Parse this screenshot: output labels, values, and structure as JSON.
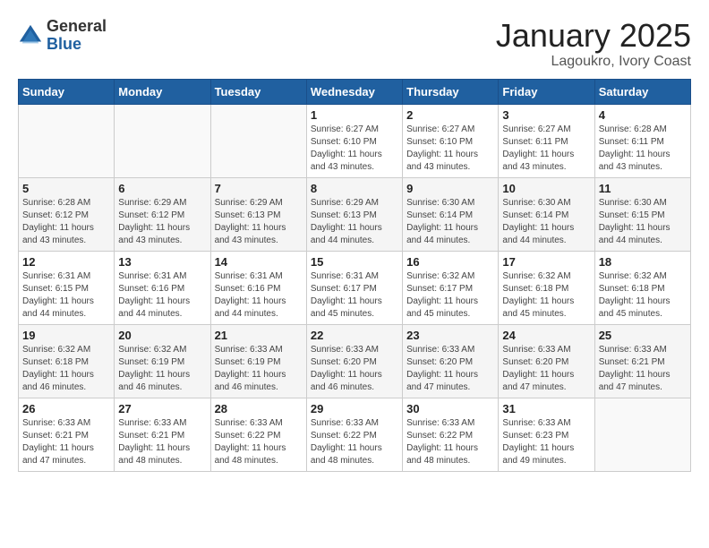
{
  "logo": {
    "general": "General",
    "blue": "Blue"
  },
  "title": "January 2025",
  "subtitle": "Lagoukro, Ivory Coast",
  "weekdays": [
    "Sunday",
    "Monday",
    "Tuesday",
    "Wednesday",
    "Thursday",
    "Friday",
    "Saturday"
  ],
  "weeks": [
    [
      {
        "day": "",
        "info": ""
      },
      {
        "day": "",
        "info": ""
      },
      {
        "day": "",
        "info": ""
      },
      {
        "day": "1",
        "info": "Sunrise: 6:27 AM\nSunset: 6:10 PM\nDaylight: 11 hours\nand 43 minutes."
      },
      {
        "day": "2",
        "info": "Sunrise: 6:27 AM\nSunset: 6:10 PM\nDaylight: 11 hours\nand 43 minutes."
      },
      {
        "day": "3",
        "info": "Sunrise: 6:27 AM\nSunset: 6:11 PM\nDaylight: 11 hours\nand 43 minutes."
      },
      {
        "day": "4",
        "info": "Sunrise: 6:28 AM\nSunset: 6:11 PM\nDaylight: 11 hours\nand 43 minutes."
      }
    ],
    [
      {
        "day": "5",
        "info": "Sunrise: 6:28 AM\nSunset: 6:12 PM\nDaylight: 11 hours\nand 43 minutes."
      },
      {
        "day": "6",
        "info": "Sunrise: 6:29 AM\nSunset: 6:12 PM\nDaylight: 11 hours\nand 43 minutes."
      },
      {
        "day": "7",
        "info": "Sunrise: 6:29 AM\nSunset: 6:13 PM\nDaylight: 11 hours\nand 43 minutes."
      },
      {
        "day": "8",
        "info": "Sunrise: 6:29 AM\nSunset: 6:13 PM\nDaylight: 11 hours\nand 44 minutes."
      },
      {
        "day": "9",
        "info": "Sunrise: 6:30 AM\nSunset: 6:14 PM\nDaylight: 11 hours\nand 44 minutes."
      },
      {
        "day": "10",
        "info": "Sunrise: 6:30 AM\nSunset: 6:14 PM\nDaylight: 11 hours\nand 44 minutes."
      },
      {
        "day": "11",
        "info": "Sunrise: 6:30 AM\nSunset: 6:15 PM\nDaylight: 11 hours\nand 44 minutes."
      }
    ],
    [
      {
        "day": "12",
        "info": "Sunrise: 6:31 AM\nSunset: 6:15 PM\nDaylight: 11 hours\nand 44 minutes."
      },
      {
        "day": "13",
        "info": "Sunrise: 6:31 AM\nSunset: 6:16 PM\nDaylight: 11 hours\nand 44 minutes."
      },
      {
        "day": "14",
        "info": "Sunrise: 6:31 AM\nSunset: 6:16 PM\nDaylight: 11 hours\nand 44 minutes."
      },
      {
        "day": "15",
        "info": "Sunrise: 6:31 AM\nSunset: 6:17 PM\nDaylight: 11 hours\nand 45 minutes."
      },
      {
        "day": "16",
        "info": "Sunrise: 6:32 AM\nSunset: 6:17 PM\nDaylight: 11 hours\nand 45 minutes."
      },
      {
        "day": "17",
        "info": "Sunrise: 6:32 AM\nSunset: 6:18 PM\nDaylight: 11 hours\nand 45 minutes."
      },
      {
        "day": "18",
        "info": "Sunrise: 6:32 AM\nSunset: 6:18 PM\nDaylight: 11 hours\nand 45 minutes."
      }
    ],
    [
      {
        "day": "19",
        "info": "Sunrise: 6:32 AM\nSunset: 6:18 PM\nDaylight: 11 hours\nand 46 minutes."
      },
      {
        "day": "20",
        "info": "Sunrise: 6:32 AM\nSunset: 6:19 PM\nDaylight: 11 hours\nand 46 minutes."
      },
      {
        "day": "21",
        "info": "Sunrise: 6:33 AM\nSunset: 6:19 PM\nDaylight: 11 hours\nand 46 minutes."
      },
      {
        "day": "22",
        "info": "Sunrise: 6:33 AM\nSunset: 6:20 PM\nDaylight: 11 hours\nand 46 minutes."
      },
      {
        "day": "23",
        "info": "Sunrise: 6:33 AM\nSunset: 6:20 PM\nDaylight: 11 hours\nand 47 minutes."
      },
      {
        "day": "24",
        "info": "Sunrise: 6:33 AM\nSunset: 6:20 PM\nDaylight: 11 hours\nand 47 minutes."
      },
      {
        "day": "25",
        "info": "Sunrise: 6:33 AM\nSunset: 6:21 PM\nDaylight: 11 hours\nand 47 minutes."
      }
    ],
    [
      {
        "day": "26",
        "info": "Sunrise: 6:33 AM\nSunset: 6:21 PM\nDaylight: 11 hours\nand 47 minutes."
      },
      {
        "day": "27",
        "info": "Sunrise: 6:33 AM\nSunset: 6:21 PM\nDaylight: 11 hours\nand 48 minutes."
      },
      {
        "day": "28",
        "info": "Sunrise: 6:33 AM\nSunset: 6:22 PM\nDaylight: 11 hours\nand 48 minutes."
      },
      {
        "day": "29",
        "info": "Sunrise: 6:33 AM\nSunset: 6:22 PM\nDaylight: 11 hours\nand 48 minutes."
      },
      {
        "day": "30",
        "info": "Sunrise: 6:33 AM\nSunset: 6:22 PM\nDaylight: 11 hours\nand 48 minutes."
      },
      {
        "day": "31",
        "info": "Sunrise: 6:33 AM\nSunset: 6:23 PM\nDaylight: 11 hours\nand 49 minutes."
      },
      {
        "day": "",
        "info": ""
      }
    ]
  ]
}
